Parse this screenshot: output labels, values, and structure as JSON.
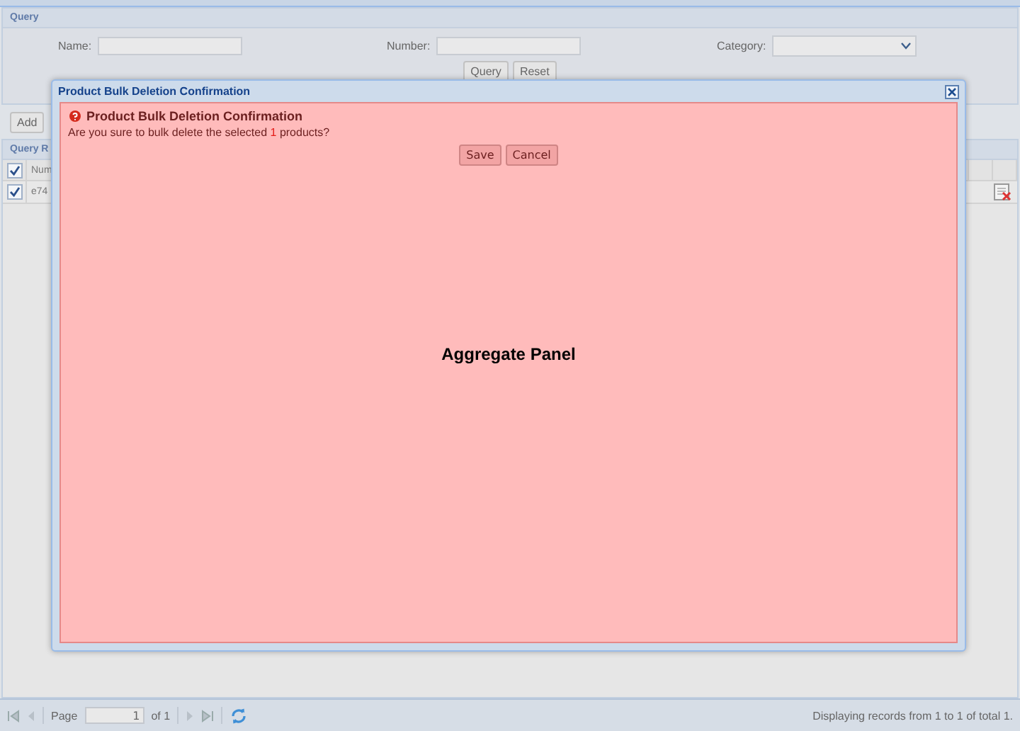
{
  "query_panel": {
    "title": "Query",
    "fields": [
      {
        "label": "Name:",
        "kind": "text"
      },
      {
        "label": "Number:",
        "kind": "text"
      },
      {
        "label": "Category:",
        "kind": "combo"
      }
    ],
    "buttons": [
      "Query",
      "Reset"
    ]
  },
  "toolbar": {
    "buttons": [
      "Add"
    ]
  },
  "results": {
    "title": "Query R",
    "header_checked": true,
    "column_1": "Num",
    "rows": [
      {
        "checked": true,
        "cell": "e74"
      }
    ]
  },
  "dialog": {
    "title": "Product Bulk Deletion Confirmation",
    "heading": "Product Bulk Deletion Confirmation",
    "message_before": "Are you sure to bulk delete the selected ",
    "count": "1",
    "message_after": " products?",
    "buttons": [
      "Save",
      "Cancel"
    ],
    "panel_label": "Aggregate Panel"
  },
  "paging": {
    "page_label": "Page",
    "page": "1",
    "of": "of 1",
    "status": "Displaying records from 1 to 1 of total 1."
  }
}
